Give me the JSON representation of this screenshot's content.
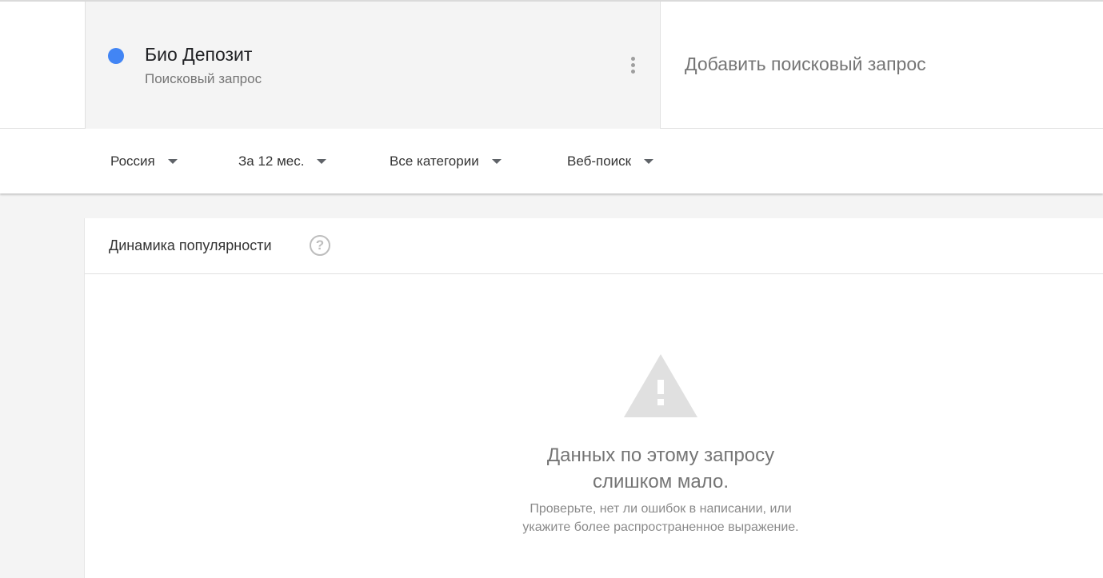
{
  "term": {
    "title": "Био Депозит",
    "subtitle": "Поисковый запрос",
    "color": "#4285f4",
    "menu_icon": "more-vert-icon"
  },
  "add_term": {
    "label": "Добавить поисковый запрос"
  },
  "filters": [
    {
      "label": "Россия"
    },
    {
      "label": "За 12 мес."
    },
    {
      "label": "Все категории"
    },
    {
      "label": "Веб-поиск"
    }
  ],
  "widget": {
    "title": "Динамика популярности",
    "help_icon": "help-circle-icon",
    "warning_icon": "warning-triangle-icon",
    "message_line1": "Данных по этому запросу",
    "message_line2": "слишком мало.",
    "hint_line1": "Проверьте, нет ли ошибок в написании, или",
    "hint_line2": "укажите более распространенное выражение."
  }
}
